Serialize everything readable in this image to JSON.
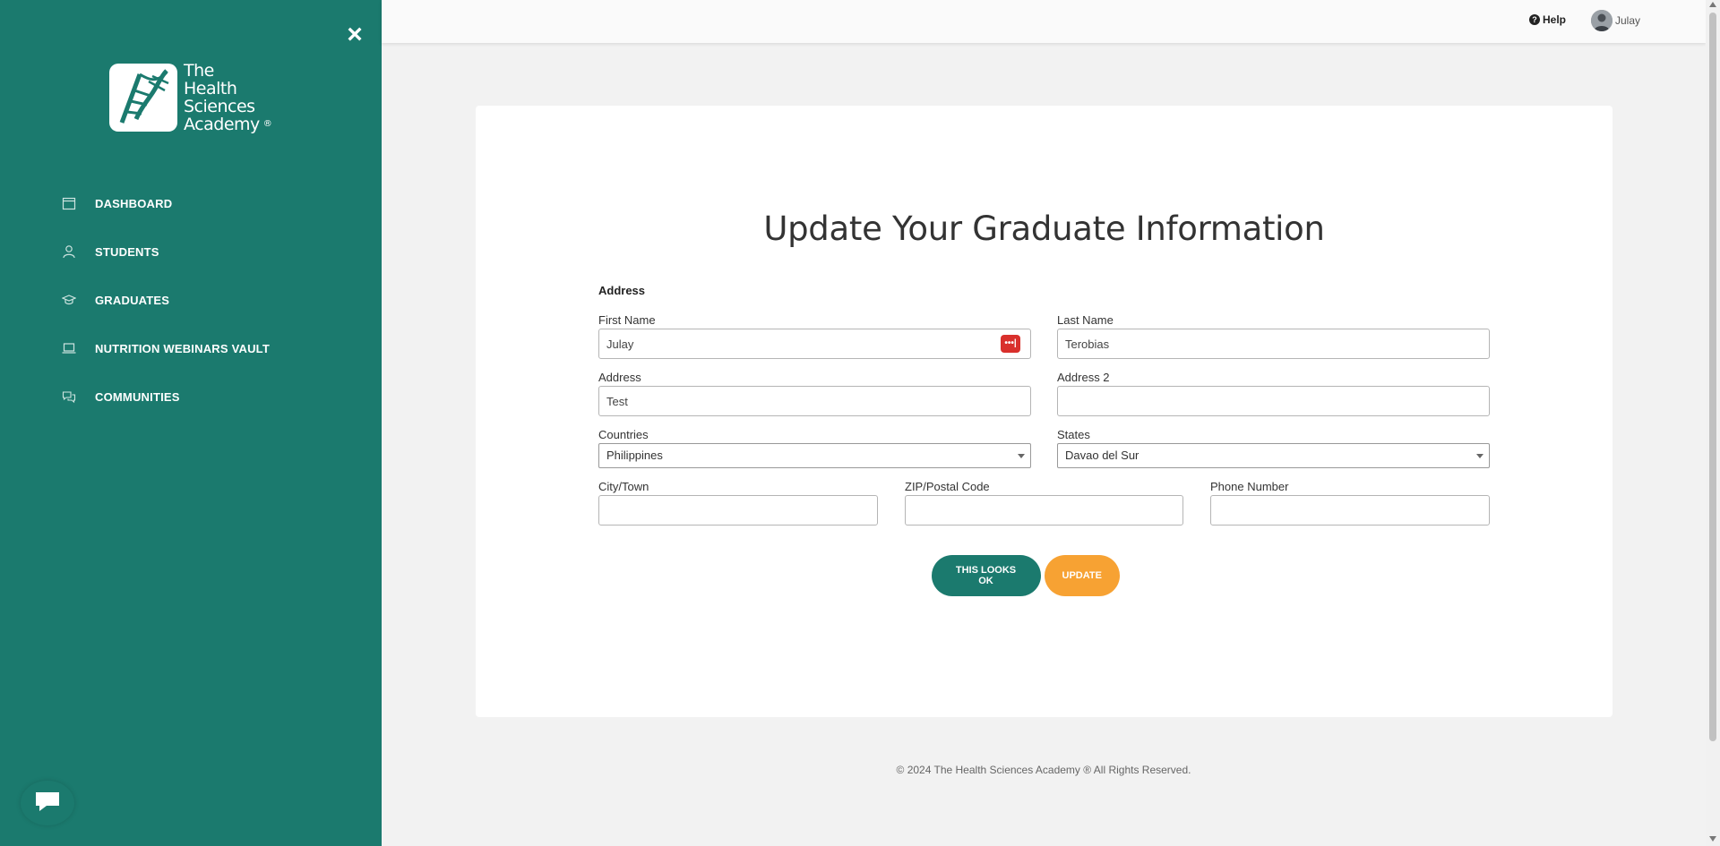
{
  "sidebar": {
    "logo_lines": [
      "The",
      "Health",
      "Sciences",
      "Academy"
    ],
    "logo_reg": "®",
    "close_icon": "×",
    "items": [
      {
        "label": "DASHBOARD",
        "icon": "calendar-icon"
      },
      {
        "label": "STUDENTS",
        "icon": "user-icon"
      },
      {
        "label": "GRADUATES",
        "icon": "graduation-cap-icon"
      },
      {
        "label": "NUTRITION WEBINARS VAULT",
        "icon": "laptop-icon"
      },
      {
        "label": "COMMUNITIES",
        "icon": "chat-icon"
      }
    ],
    "color": "#1b7a6e"
  },
  "topbar": {
    "help_label": "Help",
    "help_icon": "?",
    "user_name": "Julay"
  },
  "form": {
    "title": "Update Your Graduate Information",
    "section": "Address",
    "first_name": {
      "label": "First Name",
      "value": "Julay",
      "badge": "•••|"
    },
    "last_name": {
      "label": "Last Name",
      "value": "Terobias"
    },
    "address": {
      "label": "Address",
      "value": "Test"
    },
    "address2": {
      "label": "Address 2",
      "value": ""
    },
    "countries": {
      "label": "Countries",
      "value": "Philippines"
    },
    "states": {
      "label": "States",
      "value": "Davao del Sur"
    },
    "city": {
      "label": "City/Town",
      "value": ""
    },
    "zip": {
      "label": "ZIP/Postal Code",
      "value": ""
    },
    "phone": {
      "label": "Phone Number",
      "value": ""
    },
    "btn_ok": "THIS LOOKS OK",
    "btn_update": "UPDATE",
    "accent_ok": "#1b7a6e",
    "accent_update": "#f7a233"
  },
  "footer": "© 2024 The Health Sciences Academy ® All Rights Reserved."
}
